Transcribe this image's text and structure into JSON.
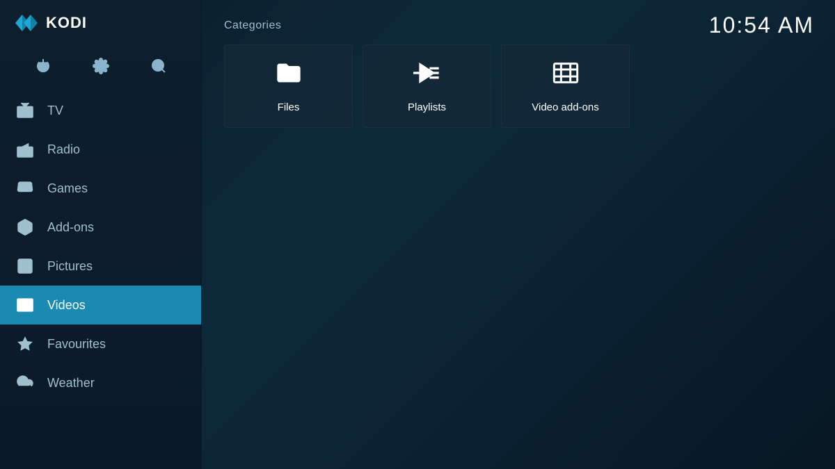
{
  "app": {
    "name": "KODI",
    "clock": "10:54 AM"
  },
  "sidebar": {
    "actions": [
      {
        "id": "power",
        "label": "Power"
      },
      {
        "id": "settings",
        "label": "Settings"
      },
      {
        "id": "search",
        "label": "Search"
      }
    ],
    "nav_items": [
      {
        "id": "tv",
        "label": "TV",
        "active": false
      },
      {
        "id": "radio",
        "label": "Radio",
        "active": false
      },
      {
        "id": "games",
        "label": "Games",
        "active": false
      },
      {
        "id": "add-ons",
        "label": "Add-ons",
        "active": false
      },
      {
        "id": "pictures",
        "label": "Pictures",
        "active": false
      },
      {
        "id": "videos",
        "label": "Videos",
        "active": true
      },
      {
        "id": "favourites",
        "label": "Favourites",
        "active": false
      },
      {
        "id": "weather",
        "label": "Weather",
        "active": false
      }
    ]
  },
  "main": {
    "categories_title": "Categories",
    "categories": [
      {
        "id": "files",
        "label": "Files"
      },
      {
        "id": "playlists",
        "label": "Playlists"
      },
      {
        "id": "video-add-ons",
        "label": "Video add-ons"
      }
    ]
  }
}
